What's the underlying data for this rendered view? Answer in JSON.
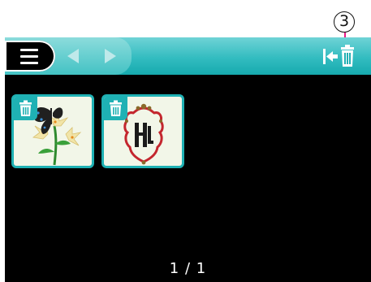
{
  "callout": {
    "number": "3"
  },
  "header": {
    "menu_icon": "hamburger-menu-icon",
    "prev_icon": "triangle-left-icon",
    "next_icon": "triangle-right-icon",
    "trash_icon": "trash-exit-icon"
  },
  "thumbnails": [
    {
      "name": "butterfly-lily-design",
      "icon": "trash-icon"
    },
    {
      "name": "monogram-frame-design",
      "icon": "trash-icon"
    }
  ],
  "pager": {
    "text": "1 / 1"
  },
  "colors": {
    "accent": "#1fb1b4",
    "background": "#000000",
    "callout_line": "#e81c85"
  }
}
